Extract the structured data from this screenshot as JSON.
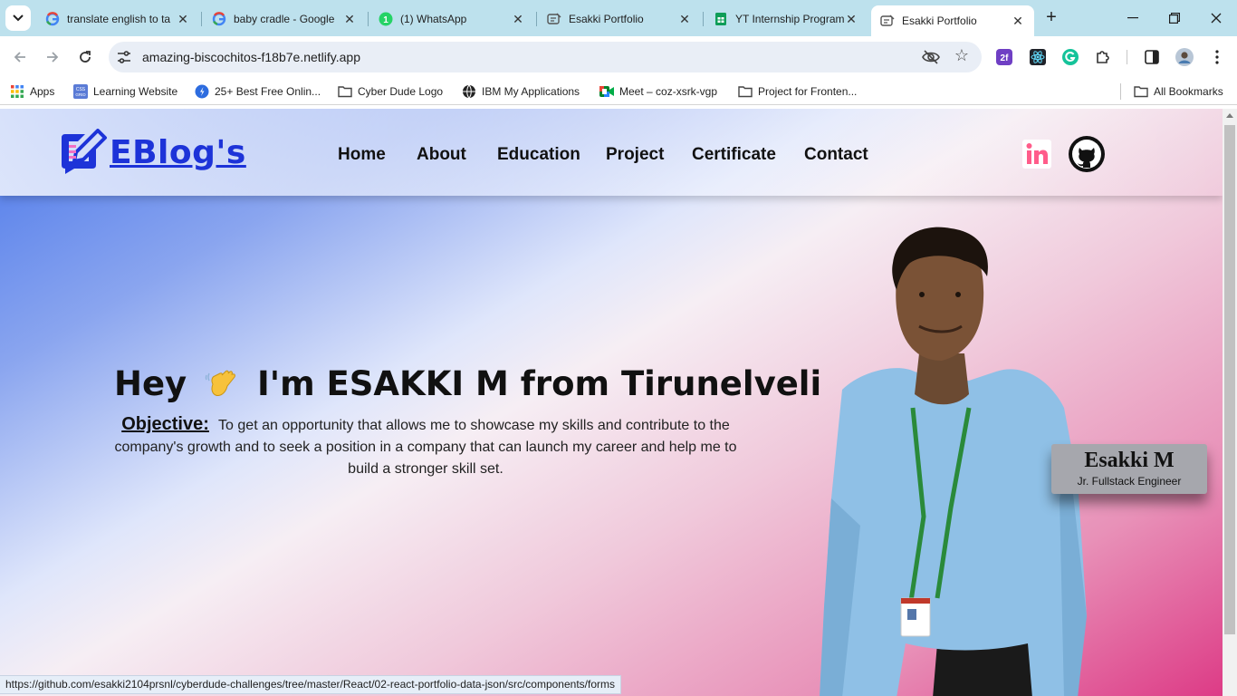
{
  "browser": {
    "tabs": [
      {
        "title": "translate english to ta",
        "icon": "google-icon",
        "active": false
      },
      {
        "title": "baby cradle - Google",
        "icon": "google-icon",
        "active": false
      },
      {
        "title": "(1) WhatsApp",
        "icon": "whatsapp-icon",
        "active": false
      },
      {
        "title": "Esakki Portfolio",
        "icon": "portfolio-favicon",
        "active": false
      },
      {
        "title": "YT Internship Program",
        "icon": "sheets-icon",
        "active": false
      },
      {
        "title": "Esakki Portfolio",
        "icon": "portfolio-favicon",
        "active": true
      }
    ],
    "url": "amazing-biscochitos-f18b7e.netlify.app",
    "bookmarks": [
      {
        "label": "Apps",
        "icon": "apps-grid-icon"
      },
      {
        "label": "Learning Website",
        "icon": "css-grid-icon"
      },
      {
        "label": "25+ Best Free Onlin...",
        "icon": "site-icon"
      },
      {
        "label": "Cyber Dude Logo",
        "icon": "folder-icon"
      },
      {
        "label": "IBM My Applications",
        "icon": "globe-icon"
      },
      {
        "label": "Meet – coz-xsrk-vgp",
        "icon": "meet-icon"
      },
      {
        "label": "Project for Fronten...",
        "icon": "folder-icon"
      },
      {
        "label": "All Bookmarks",
        "icon": "folder-icon"
      }
    ],
    "status_url": "https://github.com/esakki2104prsnl/cyberdude-challenges/tree/master/React/02-react-portfolio-data-json/src/components/forms"
  },
  "site": {
    "logo_text": "EBlog's",
    "nav": [
      "Home",
      "About",
      "Education",
      "Project",
      "Certificate",
      "Contact"
    ],
    "social": [
      "linkedin-icon",
      "github-icon"
    ],
    "hero": {
      "greeting": "Hey",
      "name_line": "I'm ESAKKI M from Tirunelveli",
      "objective_label": "Objective:",
      "objective_text": "To get an opportunity that allows me to showcase my skills and contribute to the company's growth and to seek a position in a company that can launch my career and help me to build a stronger skill set."
    },
    "card": {
      "name": "Esakki M",
      "role": "Jr. Fullstack Engineer"
    }
  },
  "colors": {
    "accent": "#1d33d8",
    "tabstrip": "#bde1ed",
    "gradient_pink": "#dd3b86",
    "gradient_blue": "#4a77ea"
  }
}
